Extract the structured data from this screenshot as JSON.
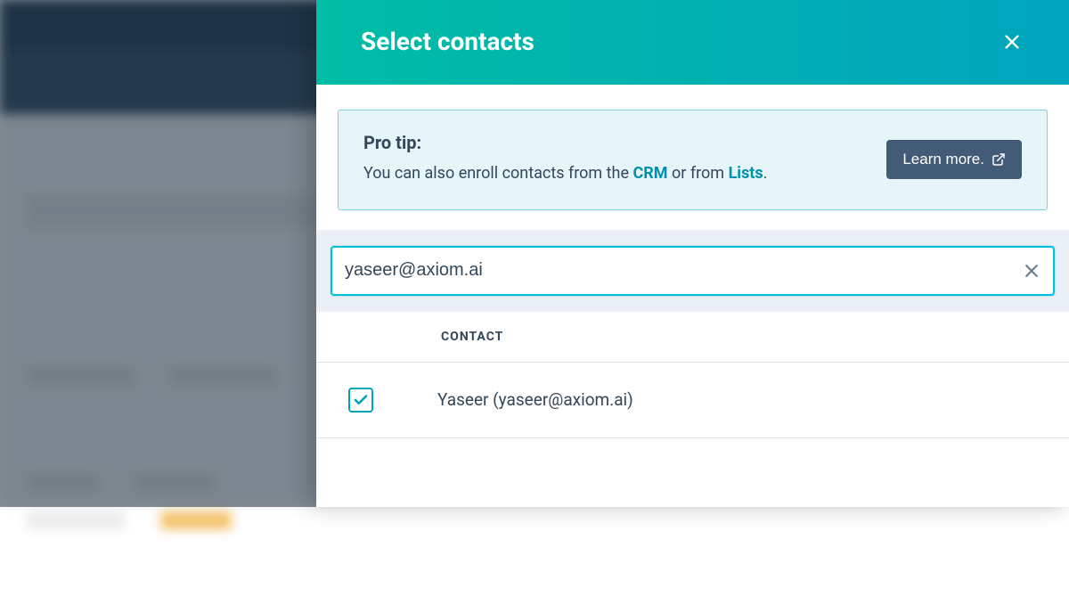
{
  "panel": {
    "title": "Select contacts"
  },
  "tip": {
    "heading": "Pro tip:",
    "before": "You can also enroll contacts from the ",
    "link1": "CRM",
    "mid": " or from ",
    "link2": "Lists",
    "after": ".",
    "learn_more": "Learn more."
  },
  "search": {
    "value": "yaseer@axiom.ai"
  },
  "columns": {
    "contact": "CONTACT"
  },
  "results": [
    {
      "label": "Yaseer (yaseer@axiom.ai)",
      "checked": true
    }
  ]
}
